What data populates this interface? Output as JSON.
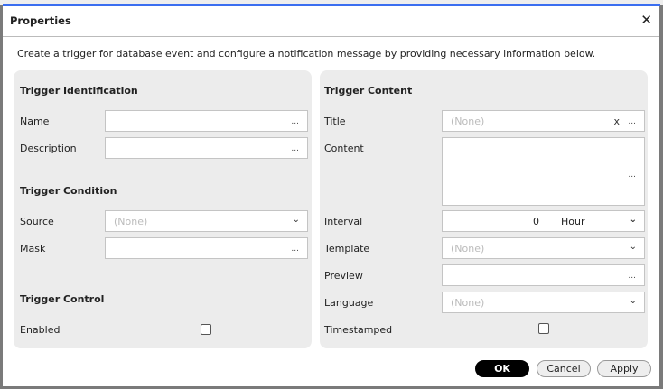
{
  "dialog": {
    "title": "Properties",
    "description": "Create a trigger for database event and configure a notification message by providing necessary information below."
  },
  "left": {
    "identification": "Trigger Identification",
    "name_label": "Name",
    "description_label": "Description",
    "condition": "Trigger Condition",
    "source_label": "Source",
    "source_value": "(None)",
    "mask_label": "Mask",
    "control": "Trigger Control",
    "enabled_label": "Enabled",
    "enabled": false
  },
  "right": {
    "content_header": "Trigger Content",
    "title_label": "Title",
    "title_placeholder": "(None)",
    "clear": "x",
    "content_label": "Content",
    "interval_label": "Interval",
    "interval_value": "0",
    "interval_unit": "Hour",
    "template_label": "Template",
    "template_value": "(None)",
    "preview_label": "Preview",
    "language_label": "Language",
    "language_value": "(None)",
    "timestamped_label": "Timestamped",
    "timestamped": false
  },
  "browse": "...",
  "buttons": {
    "ok": "OK",
    "cancel": "Cancel",
    "apply": "Apply"
  }
}
